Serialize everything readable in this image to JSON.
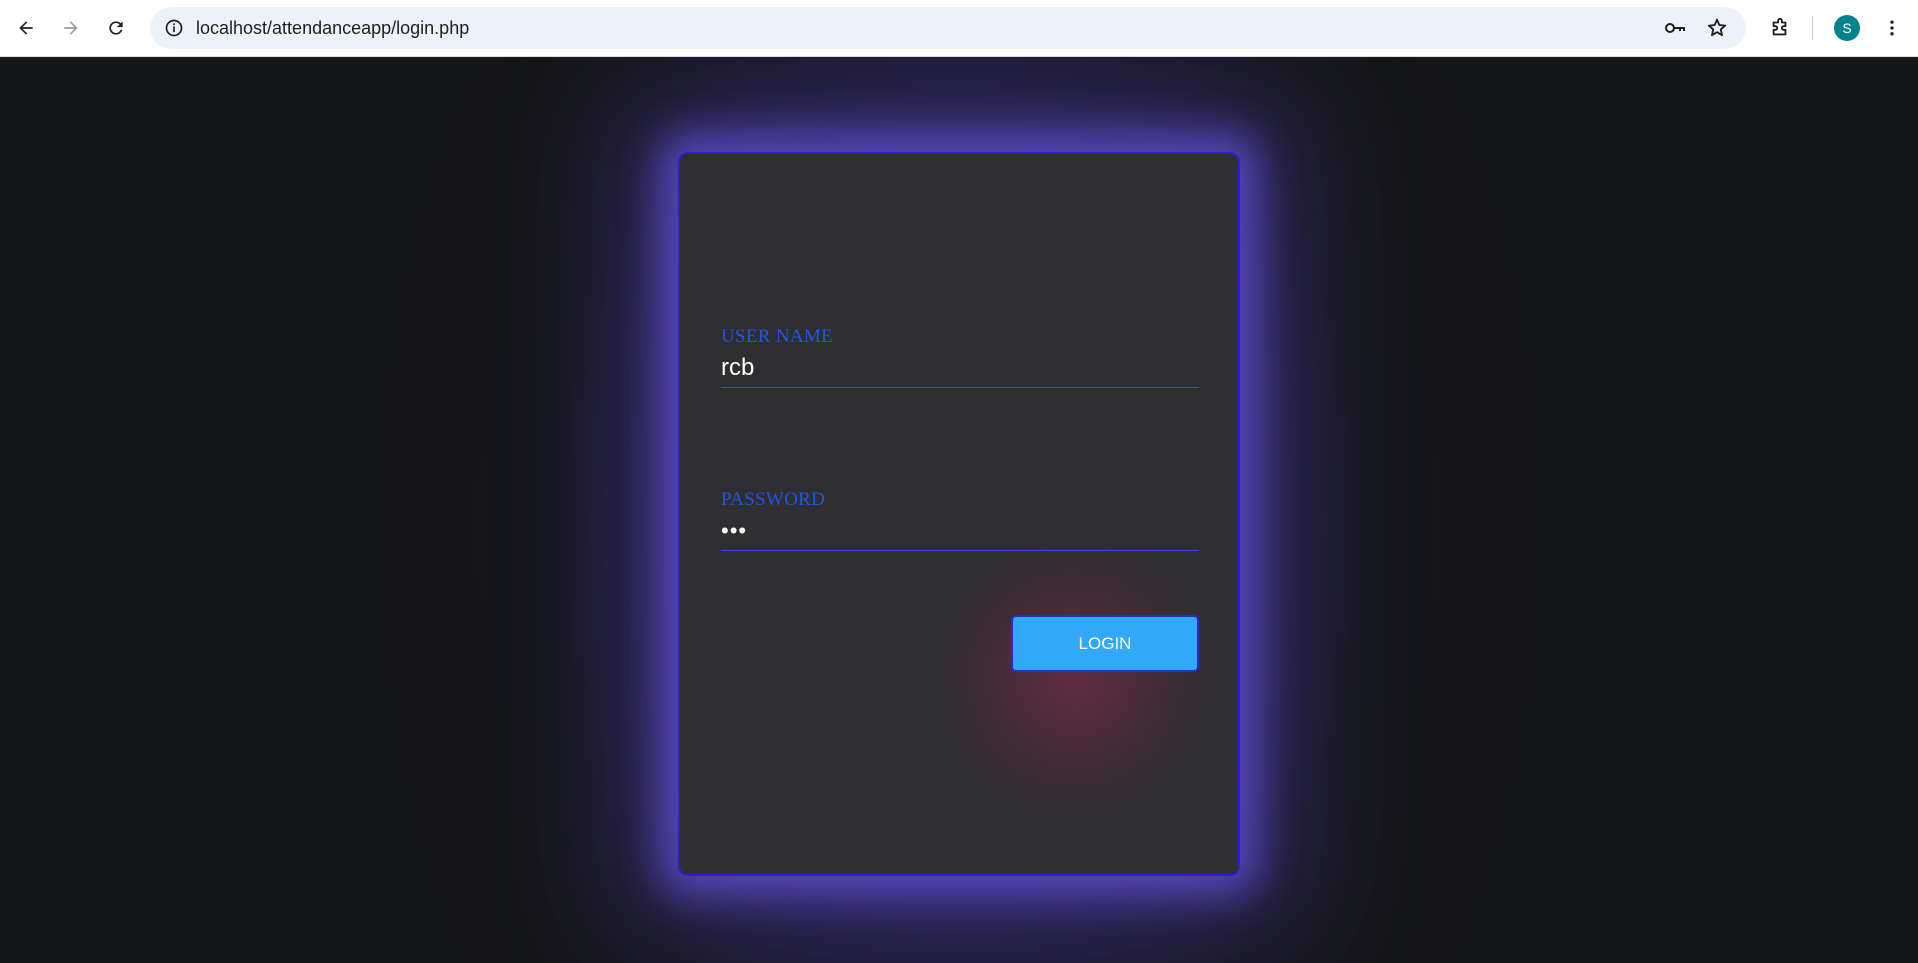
{
  "browser": {
    "url": "localhost/attendanceapp/login.php",
    "avatar_initial": "S",
    "icons": [
      "back-icon",
      "forward-icon",
      "reload-icon",
      "site-info-icon",
      "key-icon",
      "star-icon",
      "extensions-icon",
      "more-vert-icon"
    ]
  },
  "login_form": {
    "username_label": "USER NAME",
    "username_value": "rcb",
    "password_label": "PASSWORD",
    "password_value": "•••",
    "login_button": "LOGIN"
  },
  "colors": {
    "page_background": "#151617",
    "card_background": "#2f2e30",
    "card_border": "#2a1fd0",
    "label_color": "#1f55e6",
    "button_background": "#32a8f8",
    "avatar": "#00838f"
  }
}
